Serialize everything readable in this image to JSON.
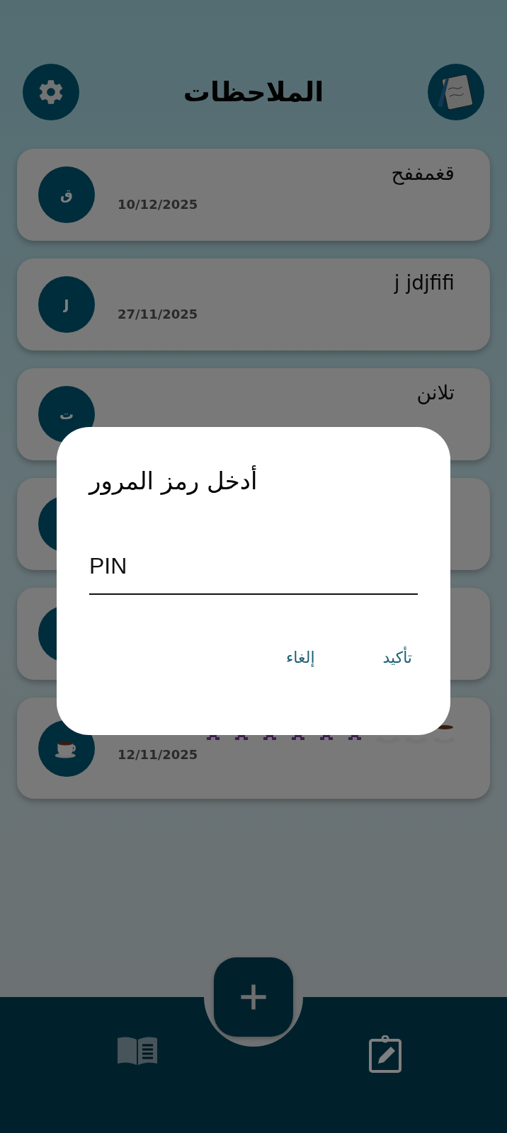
{
  "header": {
    "title": "الملاحظات"
  },
  "notes": [
    {
      "title": "قغمففح",
      "date": "10/12/2025",
      "avatar": {
        "kind": "letter",
        "letter": "ق"
      }
    },
    {
      "title": "j jdjfifi",
      "date": "27/11/2025",
      "avatar": {
        "kind": "letter",
        "letter": "J"
      }
    },
    {
      "title": "تلانن",
      "avatar": {
        "kind": "letter",
        "letter": "ت"
      }
    },
    {
      "avatar": {
        "kind": "letter"
      }
    },
    {
      "avatar": {
        "kind": "letter"
      }
    },
    {
      "kind": "emoji",
      "date": "12/11/2025",
      "avatar": {
        "kind": "cup"
      }
    }
  ],
  "dialog": {
    "title": "أدخل رمز المرور",
    "field": {
      "placeholder": "PIN"
    },
    "buttons": [
      "تأكيد",
      "إلغاء"
    ]
  },
  "bottom_nav": {
    "items": [
      {
        "kind": "book",
        "selected": false
      },
      {
        "kind": "clipboard",
        "selected": true
      }
    ]
  }
}
